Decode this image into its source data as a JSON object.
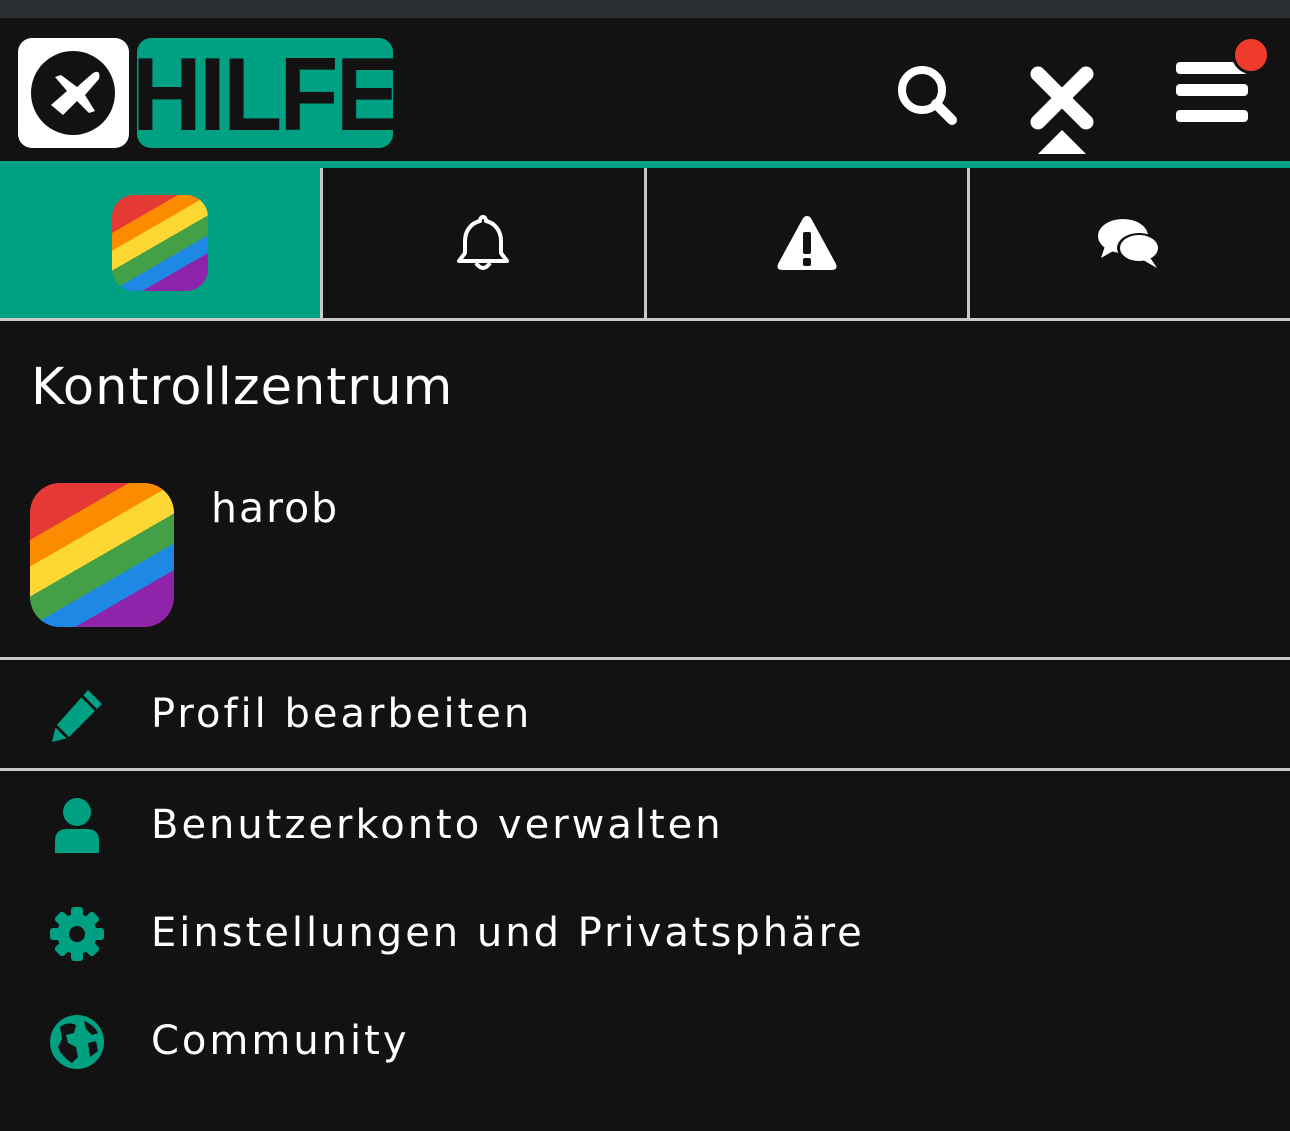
{
  "header": {
    "logo_text": "HILFE",
    "logo_icon": "plane-icon",
    "icons": [
      "search-icon",
      "close-icon",
      "hamburger-menu-icon"
    ],
    "notification_dot": true
  },
  "tabs": [
    {
      "icon": "avatar-rainbow",
      "active": true
    },
    {
      "icon": "bell-icon",
      "active": false
    },
    {
      "icon": "warning-icon",
      "active": false
    },
    {
      "icon": "chat-bubbles-icon",
      "active": false
    }
  ],
  "main": {
    "title": "Kontrollzentrum",
    "username": "harob"
  },
  "menu": {
    "items": [
      {
        "label": "Profil bearbeiten",
        "icon": "pencil-icon"
      },
      {
        "label": "Benutzerkonto verwalten",
        "icon": "user-icon"
      },
      {
        "label": "Einstellungen und Privatsphäre",
        "icon": "gear-icon"
      },
      {
        "label": "Community",
        "icon": "globe-icon"
      }
    ]
  },
  "colors": {
    "accent": "#00a082",
    "background": "#121212",
    "notification": "#f03a2c",
    "divider": "#c8c8c8"
  }
}
